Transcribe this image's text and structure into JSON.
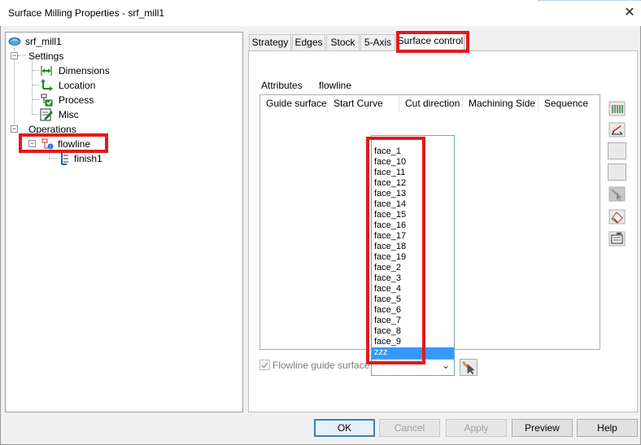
{
  "window": {
    "title": "Surface Milling Properties - srf_mill1",
    "close_glyph": "✕"
  },
  "tree": {
    "root": "srf_mill1",
    "settings": {
      "label": "Settings",
      "children": [
        "Dimensions",
        "Location",
        "Process",
        "Misc"
      ]
    },
    "operations": {
      "label": "Operations",
      "flowline": "flowline",
      "finish": "finish1"
    },
    "expander_minus": "−"
  },
  "tabs": [
    "Strategy",
    "Edges",
    "Stock",
    "5-Axis",
    "Surface control"
  ],
  "surface_control": {
    "attributes_label": "Attributes",
    "attributes_value": "flowline",
    "columns": [
      "Guide surface",
      "Start Curve",
      "Cut direction",
      "Machining Side",
      "Sequence"
    ],
    "dropdown_items": [
      "face_1",
      "face_10",
      "face_11",
      "face_12",
      "face_13",
      "face_14",
      "face_15",
      "face_16",
      "face_17",
      "face_18",
      "face_19",
      "face_2",
      "face_3",
      "face_4",
      "face_5",
      "face_6",
      "face_7",
      "face_8",
      "face_9",
      "zzz"
    ],
    "selected_item": "zzz",
    "flowline_checkbox_label": "Flowline guide surface",
    "combo_arrow": "⌄"
  },
  "buttons": {
    "ok": "OK",
    "cancel": "Cancel",
    "apply": "Apply",
    "preview": "Preview",
    "help": "Help"
  },
  "colors": {
    "highlight": "#e01b1b",
    "selection": "#3399ff",
    "checkbox_green": "#2e9e3e"
  }
}
